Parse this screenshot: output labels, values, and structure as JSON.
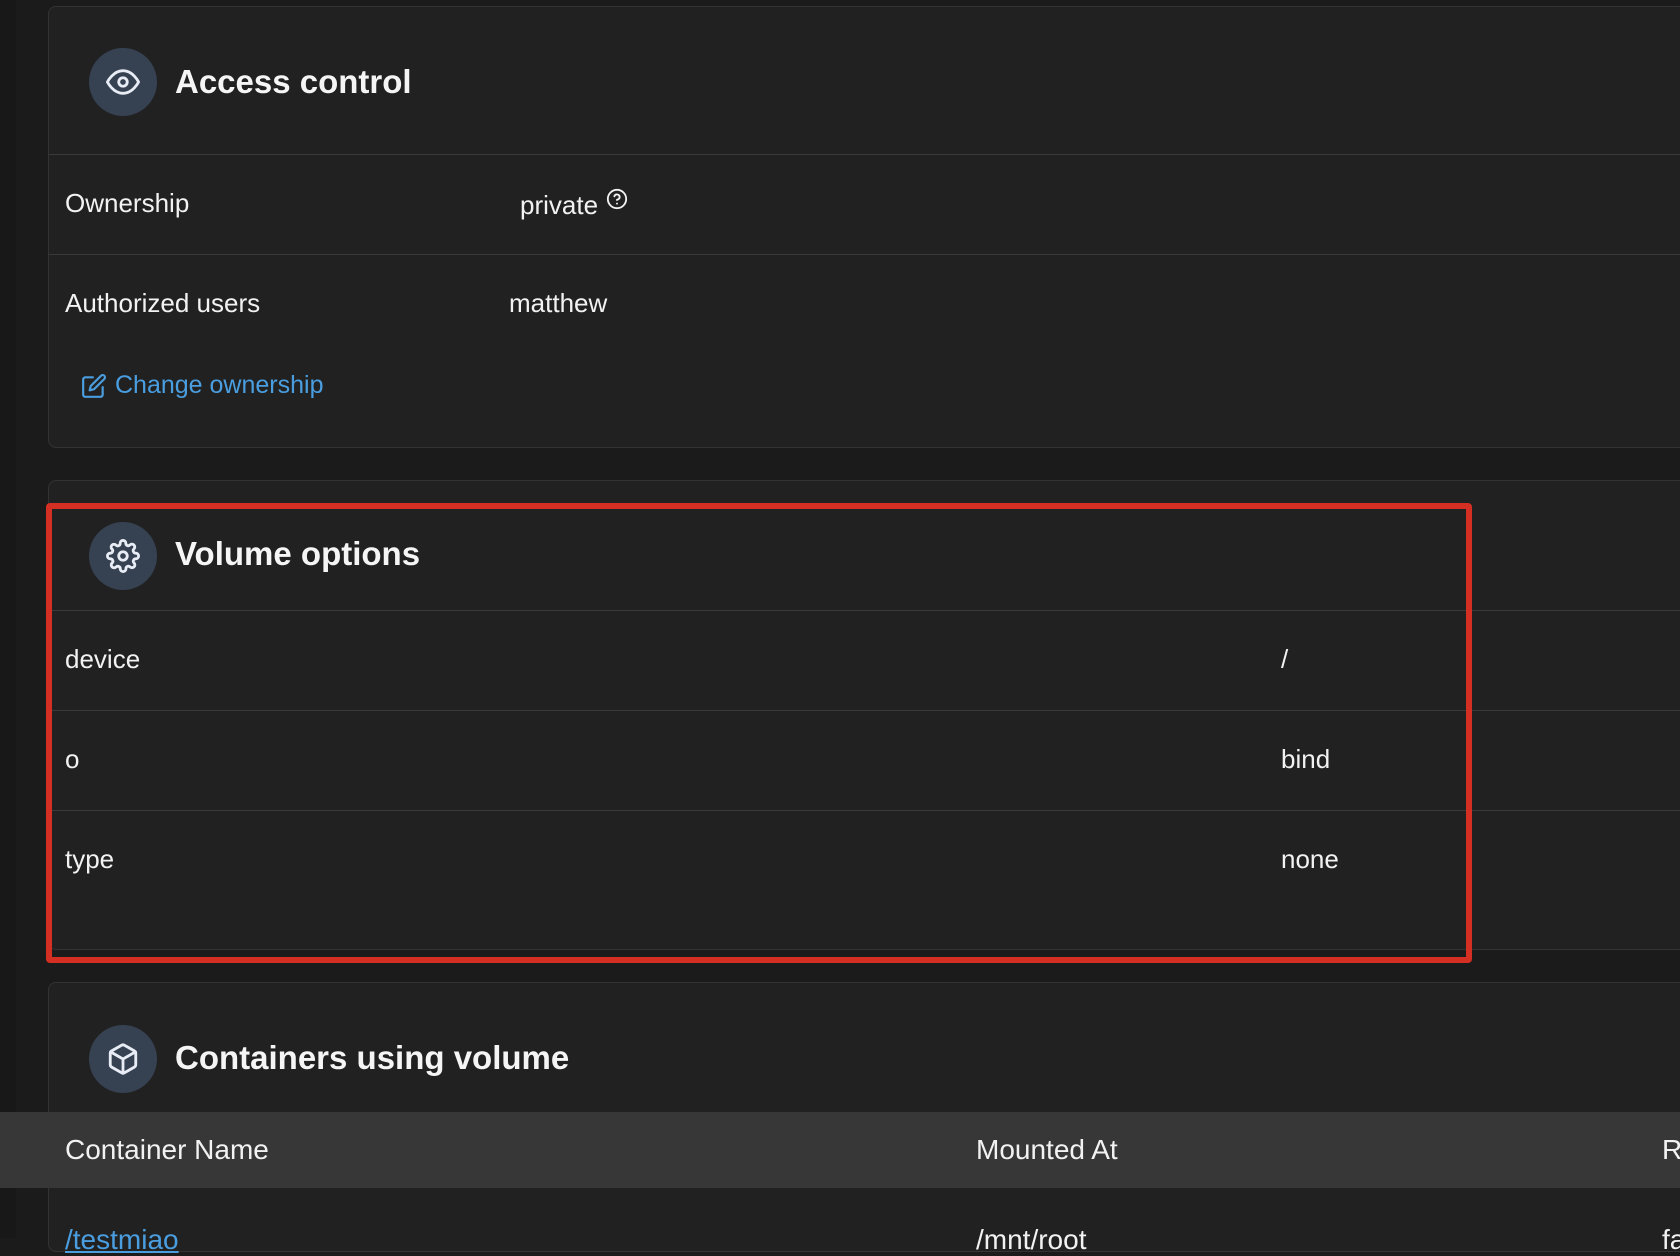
{
  "access_control": {
    "title": "Access control",
    "ownership_label": "Ownership",
    "ownership_value": "private",
    "authorized_users_label": "Authorized users",
    "authorized_users_value": "matthew",
    "change_ownership_label": "Change ownership"
  },
  "volume_options": {
    "title": "Volume options",
    "rows": [
      {
        "key": "device",
        "value": "/"
      },
      {
        "key": "o",
        "value": "bind"
      },
      {
        "key": "type",
        "value": "none"
      }
    ]
  },
  "containers": {
    "title": "Containers using volume",
    "columns": [
      "Container Name",
      "Mounted At",
      "R"
    ],
    "rows": [
      {
        "name": "/testmiao",
        "mounted_at": "/mnt/root",
        "third": "fa"
      }
    ]
  },
  "colors": {
    "accent": "#4a9ee0",
    "highlight": "#d42f23",
    "icon_bg": "#364152"
  },
  "icons": {
    "access_control": "eye-icon",
    "volume_options": "gear-icon",
    "containers": "cube-icon",
    "help": "question-circle-icon",
    "edit": "edit-icon"
  }
}
